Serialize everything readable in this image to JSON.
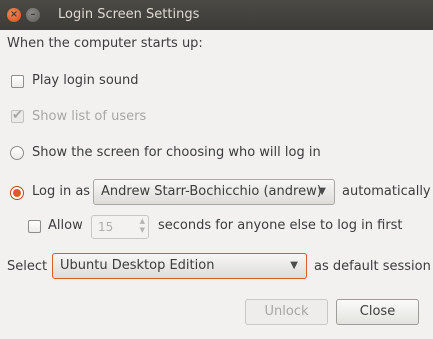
{
  "window": {
    "title": "Login Screen Settings",
    "close_glyph": "×",
    "minimize_glyph": "–"
  },
  "heading": "When the computer starts up:",
  "options": {
    "play_sound": {
      "label": "Play login sound",
      "checked": false
    },
    "show_users": {
      "label": "Show list of users",
      "checked": true,
      "disabled": true
    },
    "choose_screen": {
      "label": "Show the screen for choosing who will log in",
      "selected": false
    },
    "login_as": {
      "label": "Log in as",
      "selected": true,
      "user_value": "Andrew Starr-Bochicchio (andrew)",
      "suffix": "automatically"
    },
    "allow": {
      "label": "Allow",
      "checked": false,
      "seconds_value": "15",
      "suffix": "seconds for anyone else to log in first"
    }
  },
  "session": {
    "prefix": "Select",
    "value": "Ubuntu Desktop Edition",
    "suffix": "as default session"
  },
  "buttons": {
    "unlock": "Unlock",
    "close": "Close"
  },
  "icons": {
    "dropdown_arrow": "▼",
    "spin_up": "▲",
    "spin_down": "▼",
    "checkmark": "✔"
  },
  "colors": {
    "accent": "#e0592a",
    "titlebar": "#3c3b37",
    "background": "#f2f1f0"
  }
}
